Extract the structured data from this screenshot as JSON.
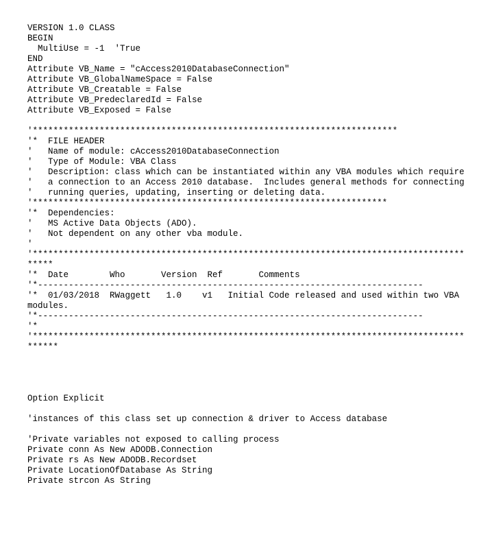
{
  "code": "VERSION 1.0 CLASS\nBEGIN\n  MultiUse = -1  'True\nEND\nAttribute VB_Name = \"cAccess2010DatabaseConnection\"\nAttribute VB_GlobalNameSpace = False\nAttribute VB_Creatable = False\nAttribute VB_PredeclaredId = False\nAttribute VB_Exposed = False\n\n'***********************************************************************\n'*  FILE HEADER\n'   Name of module: cAccess2010DatabaseConnection\n'   Type of Module: VBA Class\n'   Description: class which can be instantiated within any VBA modules which require\n'   a connection to an Access 2010 database.  Includes general methods for connecting\n'   running queries, updating, inserting or deleting data.\n'*********************************************************************\n'*  Dependencies:\n'   MS Active Data Objects (ADO).\n'   Not dependent on any other vba module.\n'\n'*****************************************************************************************\n'*  Date        Who       Version  Ref       Comments\n'*---------------------------------------------------------------------------\n'*  01/03/2018  RWaggett   1.0    v1   Initial Code released and used within two VBA modules.\n'*---------------------------------------------------------------------------\n'*\n'******************************************************************************************\n\n\n\n\nOption Explicit\n\n'instances of this class set up connection & driver to Access database\n\n'Private variables not exposed to calling process\nPrivate conn As New ADODB.Connection\nPrivate rs As New ADODB.Recordset\nPrivate LocationOfDatabase As String\nPrivate strcon As String"
}
